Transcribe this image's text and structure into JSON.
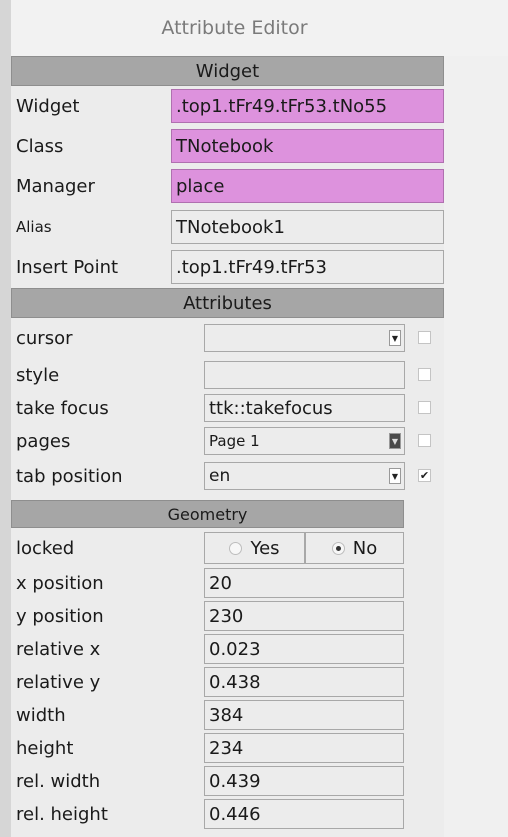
{
  "title": "Attribute Editor",
  "sections": {
    "widget": "Widget",
    "attributes": "Attributes",
    "geometry": "Geometry"
  },
  "widget_rows": [
    {
      "label": "Widget",
      "value": ".top1.tFr49.tFr53.tNo55"
    },
    {
      "label": "Class",
      "value": "TNotebook"
    },
    {
      "label": "Manager",
      "value": "place"
    },
    {
      "label": "Alias",
      "value": "TNotebook1"
    },
    {
      "label": "Insert Point",
      "value": ".top1.tFr49.tFr53"
    }
  ],
  "attribute_rows": [
    {
      "label": "cursor",
      "value": "",
      "checked": false
    },
    {
      "label": "style",
      "value": "",
      "checked": false
    },
    {
      "label": "take focus",
      "value": "ttk::takefocus",
      "checked": false
    },
    {
      "label": "pages",
      "value": "Page 1",
      "checked": false
    },
    {
      "label": "tab position",
      "value": "en",
      "checked": true
    }
  ],
  "geometry": {
    "locked_label": "locked",
    "locked_yes": "Yes",
    "locked_no": "No",
    "locked_selected": "No",
    "rows": [
      {
        "label": "x position",
        "value": "20"
      },
      {
        "label": "y position",
        "value": "230"
      },
      {
        "label": "relative x",
        "value": "0.023"
      },
      {
        "label": "relative y",
        "value": "0.438"
      },
      {
        "label": "width",
        "value": "384"
      },
      {
        "label": "height",
        "value": "234"
      },
      {
        "label": "rel. width",
        "value": "0.439"
      },
      {
        "label": "rel. height",
        "value": "0.446"
      }
    ]
  },
  "colors": {
    "highlight": "#dd92dd",
    "header": "#a6a6a6",
    "panel": "#ececec"
  }
}
